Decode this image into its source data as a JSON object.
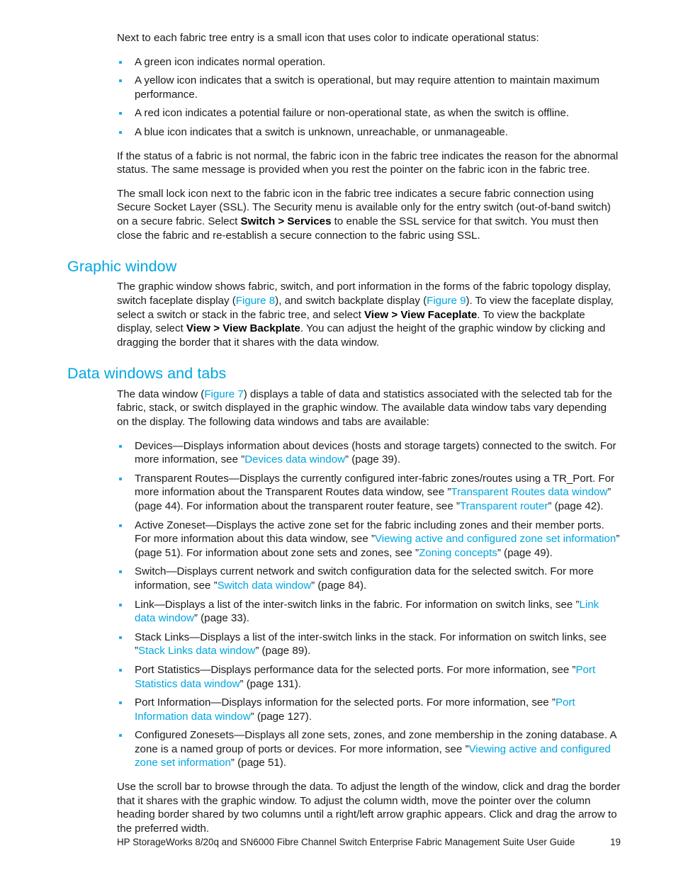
{
  "document": {
    "intro_paragraph": "Next to each fabric tree entry is a small icon that uses color to indicate operational status:",
    "status_bullets": [
      "A green icon indicates normal operation.",
      "A yellow icon indicates that a switch is operational, but may require attention to maintain maximum performance.",
      "A red icon indicates a potential failure or non-operational state, as when the switch is offline.",
      "A blue icon indicates that a switch is unknown, unreachable, or unmanageable."
    ],
    "abnormal_status_paragraph": "If the status of a fabric is not normal, the fabric icon in the fabric tree indicates the reason for the abnormal status. The same message is provided when you rest the pointer on the fabric icon in the fabric tree.",
    "lock_icon_paragraph": {
      "part1": "The small lock icon next to the fabric icon in the fabric tree indicates a secure fabric connection using Secure Socket Layer (SSL). The Security menu is available only for the entry switch (out-of-band switch) on a secure fabric. Select ",
      "bold1": "Switch > Services",
      "part2": " to enable the SSL service for that switch. You must then close the fabric and re-establish a secure connection to the fabric using SSL."
    },
    "sections": [
      {
        "heading": "Graphic window",
        "paragraph": {
          "part1": "The graphic window shows fabric, switch, and port information in the forms of the fabric topology display, switch faceplate display (",
          "link1": "Figure 8",
          "part2": "), and switch backplate display (",
          "link2": "Figure 9",
          "part3": "). To view the faceplate display, select a switch or stack in the fabric tree, and select ",
          "bold1": "View > View Faceplate",
          "part4": ". To view the backplate display, select ",
          "bold2": "View > View Backplate",
          "part5": ". You can adjust the height of the graphic window by clicking and dragging the border that it shares with the data window."
        }
      },
      {
        "heading": "Data windows and tabs",
        "paragraph": {
          "part1": "The data window (",
          "link1": "Figure 7",
          "part2": ") displays a table of data and statistics associated with the selected tab for the fabric, stack, or switch displayed in the graphic window. The available data window tabs vary depending on the display. The following data windows and tabs are available:"
        }
      }
    ],
    "tab_bullets": [
      {
        "part1": "Devices—Displays information about devices (hosts and storage targets) connected to the switch. For more information, see ”",
        "link1": "Devices data window",
        "part2": "” (page 39)."
      },
      {
        "part1": "Transparent Routes—Displays the currently configured inter-fabric zones/routes using a TR_Port. For more information about the Transparent Routes data window, see ”",
        "link1": "Transparent Routes data window",
        "part2": "” (page 44). For information about the transparent router feature, see ”",
        "link2": "Transparent router",
        "part3": "” (page 42)."
      },
      {
        "part1": "Active Zoneset—Displays the active zone set for the fabric including zones and their member ports. For more information about this data window, see ”",
        "link1": "Viewing active and configured zone set information",
        "part2": "” (page 51). For information about zone sets and zones, see ”",
        "link2": "Zoning concepts",
        "part3": "” (page 49)."
      },
      {
        "part1": "Switch—Displays current network and switch configuration data for the selected switch. For more information, see ”",
        "link1": "Switch data window",
        "part2": "” (page 84)."
      },
      {
        "part1": "Link—Displays a list of the inter-switch links in the fabric. For information on switch links, see ”",
        "link1": "Link data window",
        "part2": "” (page 33)."
      },
      {
        "part1": "Stack Links—Displays a list of the inter-switch links in the stack. For information on switch links, see ”",
        "link1": "Stack Links data window",
        "part2": "” (page 89)."
      },
      {
        "part1": "Port Statistics—Displays performance data for the selected ports. For more information, see ”",
        "link1": "Port Statistics data window",
        "part2": "” (page 131)."
      },
      {
        "part1": "Port Information—Displays information for the selected ports. For more information, see ”",
        "link1": "Port Information data window",
        "part2": "” (page 127)."
      },
      {
        "part1": "Configured Zonesets—Displays all zone sets, zones, and zone membership in the zoning database. A zone is a named group of ports or devices. For more information, see ”",
        "link1": "Viewing active and configured zone set information",
        "part2": "” (page 51)."
      }
    ],
    "closing_paragraph": "Use the scroll bar to browse through the data. To adjust the length of the window, click and drag the border that it shares with the graphic window. To adjust the column width, move the pointer over the column heading border shared by two columns until a right/left arrow graphic appears. Click and drag the arrow to the preferred width.",
    "footer": {
      "title": "HP StorageWorks 8/20q and SN6000 Fibre Channel Switch Enterprise Fabric Management Suite User Guide",
      "page_number": "19"
    },
    "colors": {
      "heading": "#00a6e2",
      "link": "#00a6e2",
      "bullet": "#21a9e1",
      "text": "#1a1a1a"
    }
  }
}
